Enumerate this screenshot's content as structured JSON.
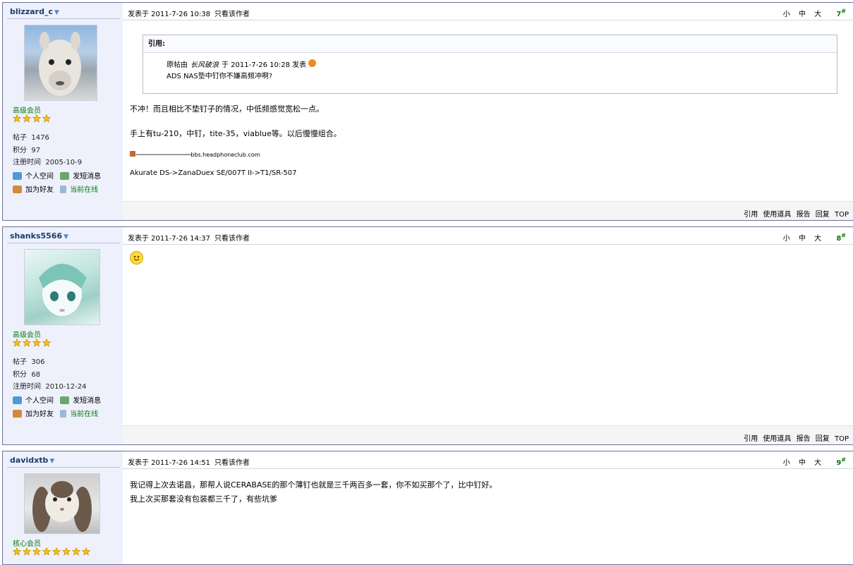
{
  "posts": [
    {
      "username": "blizzard_c",
      "rank": "高级会员",
      "stars": 4,
      "posts_label": "帖子",
      "posts": "1476",
      "points_label": "积分",
      "points": "97",
      "reg_label": "注册时间",
      "reg": "2005-10-9",
      "space": "个人空间",
      "msg": "发短消息",
      "friend": "加为好友",
      "online": "当前在线",
      "posted": "发表于 2011-7-26 10:38",
      "only_author": "只看该作者",
      "size_s": "小",
      "size_m": "中",
      "size_l": "大",
      "floor": "7",
      "quote_title": "引用:",
      "quote_meta_a": "原帖由",
      "quote_author": "长风破浪",
      "quote_meta_b": "于 2011-7-26 10:28 发表",
      "quote_text": "ADS NAS垫中钉你不嫌高频冲啊?",
      "line1": "不冲！而且相比不垫钉子的情况，中低频感觉宽松一点。",
      "line2": "手上有tu-210，中钉，tite-35，viablue等。以后慢慢组合。",
      "sig_dashes": "------------------------------",
      "sig_site": "bbs.headphoneclub.com",
      "sig_gear": "Akurate DS->ZanaDuex SE/007T II->T1/SR-507",
      "acts": [
        "引用",
        "使用道具",
        "报告",
        "回复",
        "TOP"
      ]
    },
    {
      "username": "shanks5566",
      "rank": "高级会员",
      "stars": 4,
      "posts_label": "帖子",
      "posts": "306",
      "points_label": "积分",
      "points": "68",
      "reg_label": "注册时间",
      "reg": "2010-12-24",
      "space": "个人空间",
      "msg": "发短消息",
      "friend": "加为好友",
      "online": "当前在线",
      "posted": "发表于 2011-7-26 14:37",
      "only_author": "只看该作者",
      "size_s": "小",
      "size_m": "中",
      "size_l": "大",
      "floor": "8",
      "acts": [
        "引用",
        "使用道具",
        "报告",
        "回复",
        "TOP"
      ]
    },
    {
      "username": "davidxtb",
      "rank": "核心会员",
      "stars": 8,
      "posted": "发表于 2011-7-26 14:51",
      "only_author": "只看该作者",
      "size_s": "小",
      "size_m": "中",
      "size_l": "大",
      "floor": "9",
      "line1": "我记得上次去诺昌，那帮人说CERABASE的那个薄钉也就是三千两百多一套，你不如买那个了，比中钉好。",
      "line2": "我上次买那套没有包装都三千了，有些坑爹"
    }
  ],
  "colors": {
    "rank_green": "#0a7a10",
    "sidebar_bg": "#eef1fc",
    "border": "#6b6f9e",
    "name_blue": "#1b3a6b"
  }
}
